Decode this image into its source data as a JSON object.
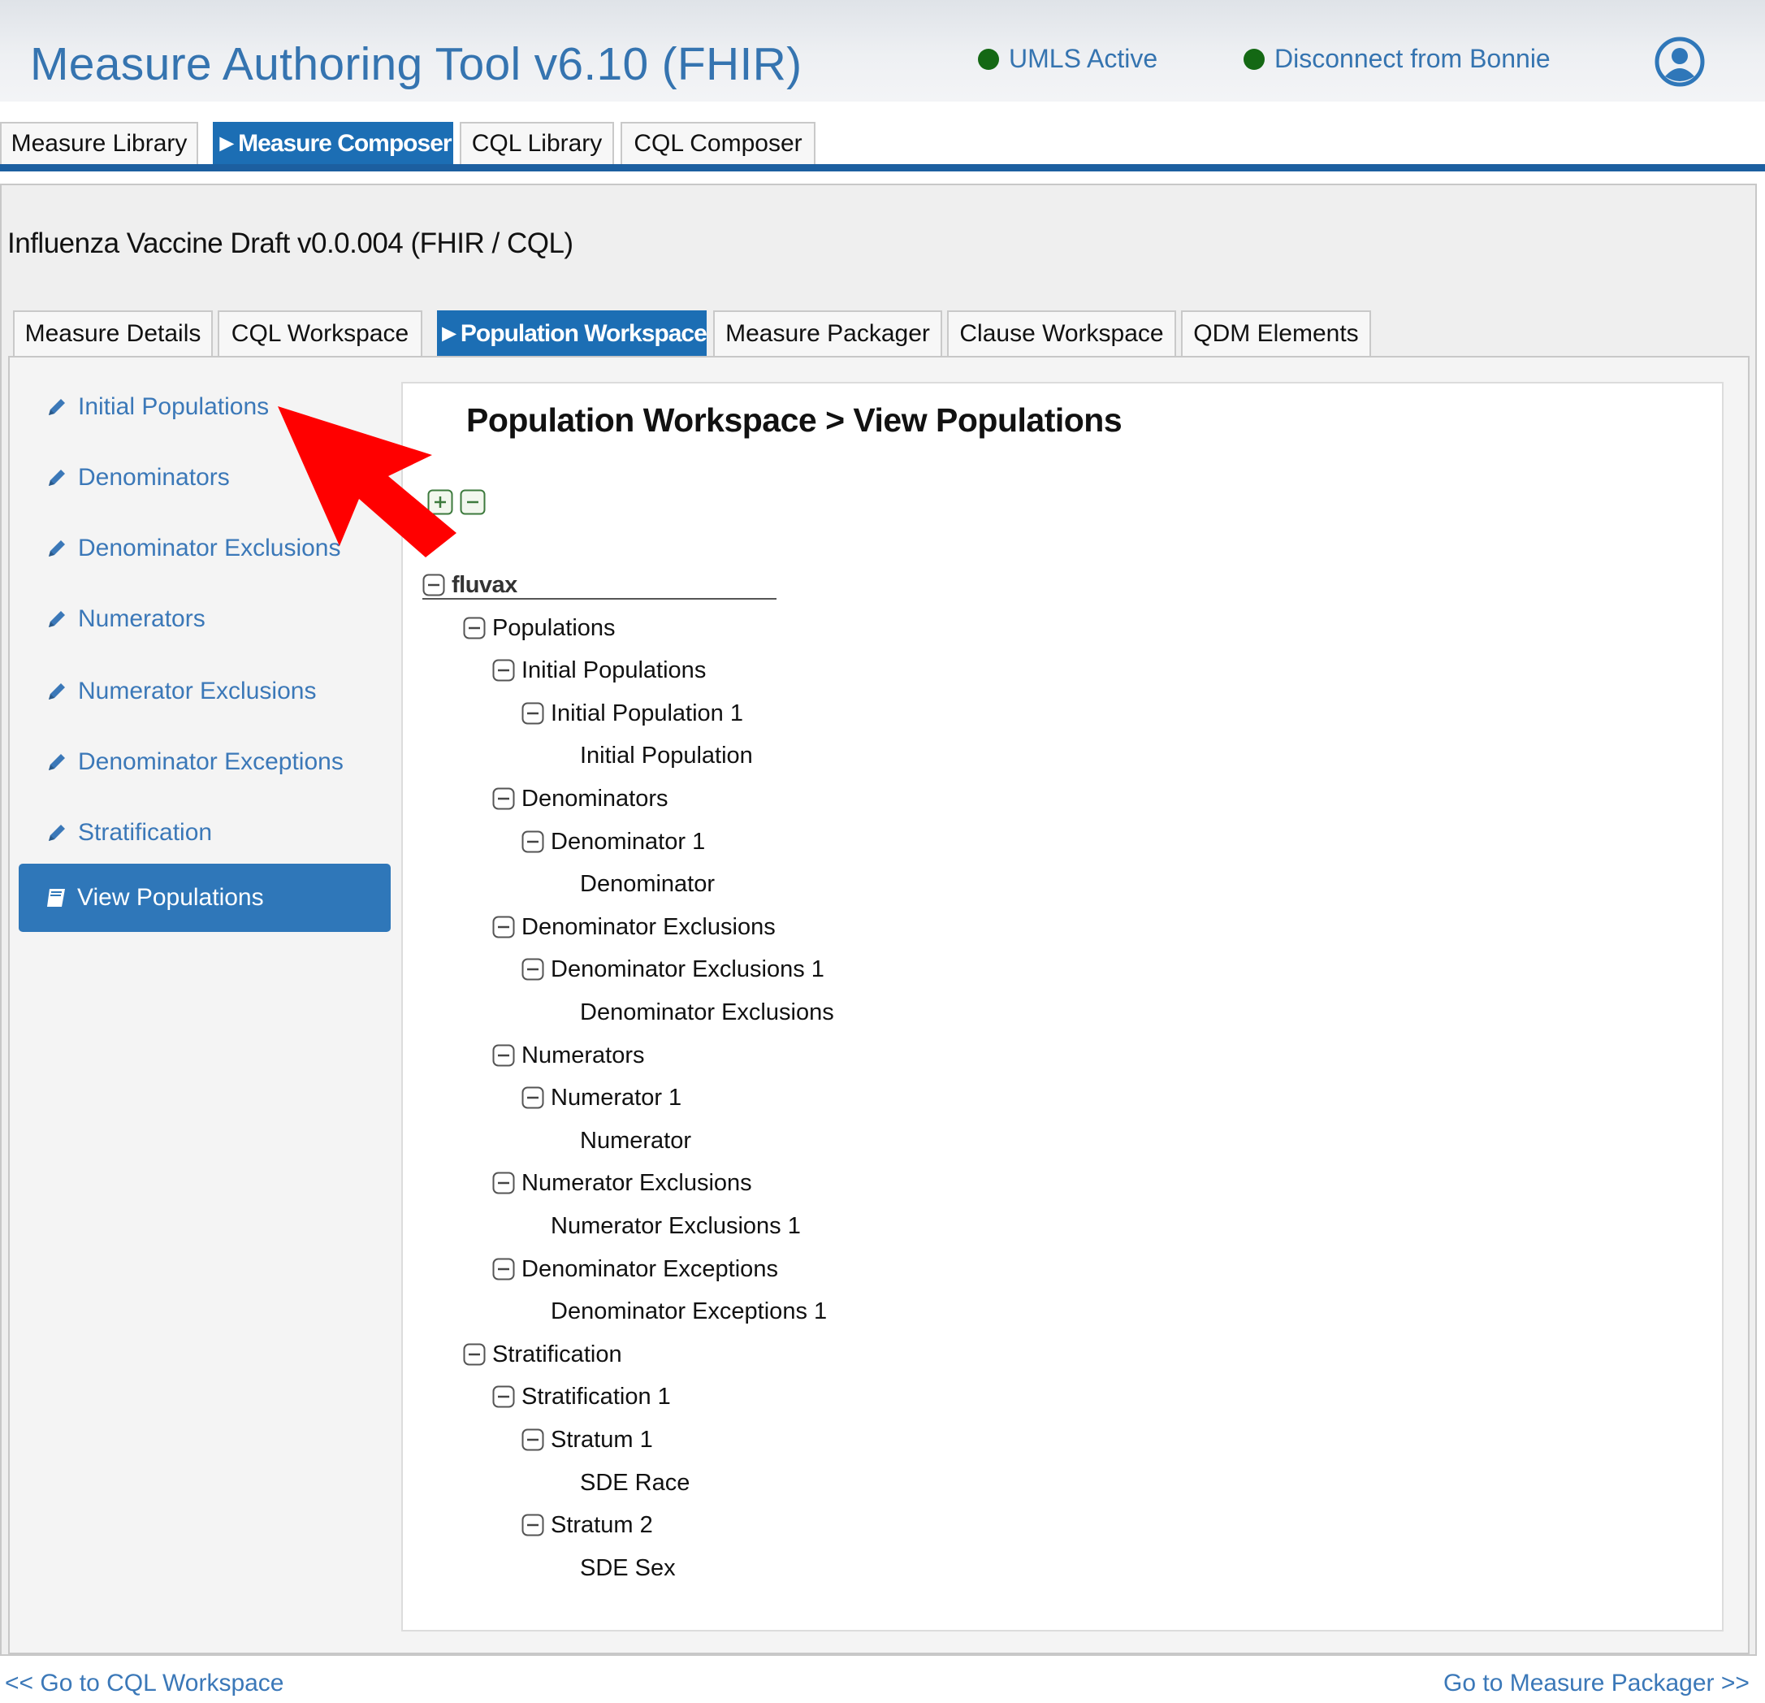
{
  "header": {
    "app_title": "Measure Authoring Tool v6.10 (FHIR)",
    "umls_status": "UMLS Active",
    "bonnie_link": "Disconnect from Bonnie",
    "status_color": "#146814"
  },
  "main_tabs": [
    {
      "label": "Measure Library"
    },
    {
      "label": "►Measure Composer",
      "active": true
    },
    {
      "label": "CQL Library"
    },
    {
      "label": "CQL Composer"
    }
  ],
  "measure": {
    "title": "Influenza Vaccine Draft v0.0.004 (FHIR / CQL)"
  },
  "sub_tabs": [
    {
      "label": "Measure Details"
    },
    {
      "label": "CQL Workspace"
    },
    {
      "label": "►Population Workspace",
      "active": true
    },
    {
      "label": "Measure Packager"
    },
    {
      "label": "Clause Workspace"
    },
    {
      "label": "QDM Elements"
    }
  ],
  "nav": {
    "items": [
      {
        "label": "Initial Populations",
        "icon": "pencil-icon"
      },
      {
        "label": "Denominators",
        "icon": "pencil-icon"
      },
      {
        "label": "Denominator Exclusions",
        "icon": "pencil-icon"
      },
      {
        "label": "Numerators",
        "icon": "pencil-icon"
      },
      {
        "label": "Numerator Exclusions",
        "icon": "pencil-icon"
      },
      {
        "label": "Denominator Exceptions",
        "icon": "pencil-icon"
      },
      {
        "label": "Stratification",
        "icon": "pencil-icon"
      },
      {
        "label": "View Populations",
        "icon": "book-icon",
        "active": true
      }
    ]
  },
  "content": {
    "title": "Population Workspace > View Populations"
  },
  "tree": [
    {
      "label": "fluvax",
      "level": 0,
      "collapsible": true
    },
    {
      "label": "Populations",
      "level": 1,
      "collapsible": true
    },
    {
      "label": "Initial Populations",
      "level": 2,
      "collapsible": true
    },
    {
      "label": "Initial Population 1",
      "level": 3,
      "collapsible": true
    },
    {
      "label": "Initial Population",
      "level": 4,
      "collapsible": false
    },
    {
      "label": "Denominators",
      "level": 2,
      "collapsible": true
    },
    {
      "label": "Denominator 1",
      "level": 3,
      "collapsible": true
    },
    {
      "label": "Denominator",
      "level": 4,
      "collapsible": false
    },
    {
      "label": "Denominator Exclusions",
      "level": 2,
      "collapsible": true
    },
    {
      "label": "Denominator Exclusions 1",
      "level": 3,
      "collapsible": true
    },
    {
      "label": "Denominator Exclusions",
      "level": 4,
      "collapsible": false
    },
    {
      "label": "Numerators",
      "level": 2,
      "collapsible": true
    },
    {
      "label": "Numerator 1",
      "level": 3,
      "collapsible": true
    },
    {
      "label": "Numerator",
      "level": 4,
      "collapsible": false
    },
    {
      "label": "Numerator Exclusions",
      "level": 2,
      "collapsible": true
    },
    {
      "label": "Numerator Exclusions 1",
      "level": 3,
      "collapsible": false
    },
    {
      "label": "Denominator Exceptions",
      "level": 2,
      "collapsible": true
    },
    {
      "label": "Denominator Exceptions 1",
      "level": 3,
      "collapsible": false
    },
    {
      "label": "Stratification",
      "level": 1,
      "collapsible": true
    },
    {
      "label": "Stratification 1",
      "level": 2,
      "collapsible": true
    },
    {
      "label": "Stratum 1",
      "level": 3,
      "collapsible": true
    },
    {
      "label": "SDE Race",
      "level": 4,
      "collapsible": false
    },
    {
      "label": "Stratum 2",
      "level": 3,
      "collapsible": true
    },
    {
      "label": "SDE Sex",
      "level": 4,
      "collapsible": false
    }
  ],
  "footer": {
    "prev_link": "<< Go to CQL Workspace",
    "next_link": "Go to Measure Packager >>"
  },
  "colors": {
    "accent": "#1c6eb4",
    "link": "#3b78b8",
    "annotation_arrow": "#ff0000"
  }
}
